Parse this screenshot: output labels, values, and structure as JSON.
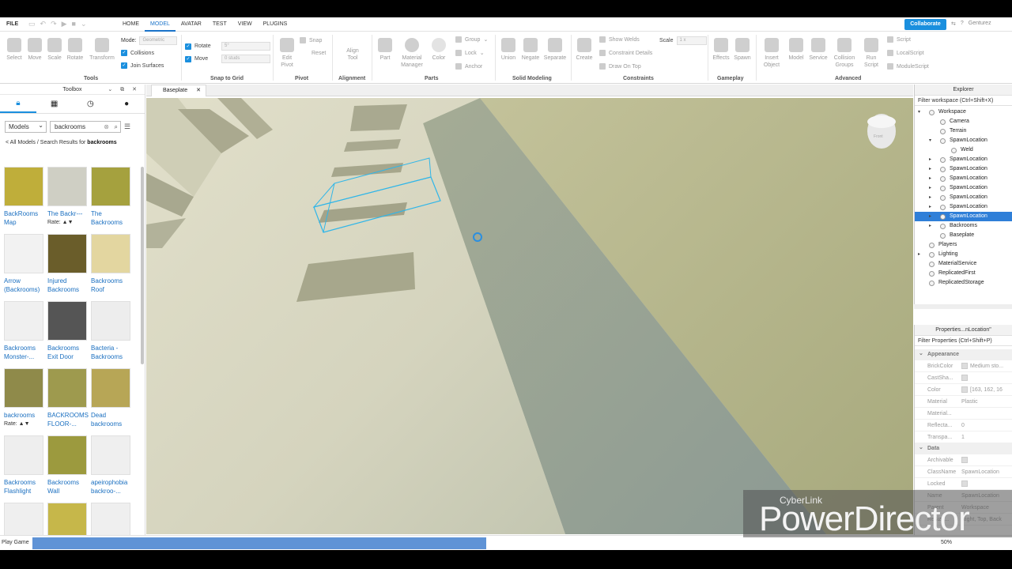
{
  "menu": {
    "file": "FILE",
    "tabs": [
      "HOME",
      "MODEL",
      "AVATAR",
      "TEST",
      "VIEW",
      "PLUGINS"
    ],
    "active_tab": "MODEL",
    "collaborate": "Collaborate",
    "user": "Genturez"
  },
  "ribbon": {
    "tools": [
      "Select",
      "Move",
      "Scale",
      "Rotate",
      "Transform"
    ],
    "mode_label": "Mode:",
    "mode_value": "Geometric",
    "collisions": "Collisions",
    "join_surfaces": "Join Surfaces",
    "rotate_label": "Rotate",
    "rotate_value": "5°",
    "move_label": "Move",
    "move_value": "0 studs",
    "edit_pivot": "Edit Pivot",
    "snap": "Snap",
    "reset": "Reset",
    "align_tool": "Align Tool",
    "part": "Part",
    "material_manager": "Material Manager",
    "color": "Color",
    "group": "Group",
    "lock": "Lock",
    "anchor": "Anchor",
    "union": "Union",
    "negate": "Negate",
    "separate": "Separate",
    "create": "Create",
    "show_welds": "Show Welds",
    "constraint_details": "Constraint Details",
    "draw_on_top": "Draw On Top",
    "scale_label": "Scale",
    "scale_value": "1 x",
    "effects": "Effects",
    "spawn": "Spawn",
    "insert_object": "Insert Object",
    "model": "Model",
    "service": "Service",
    "collision_groups": "Collision Groups",
    "run_script": "Run Script",
    "script": "Script",
    "local_script": "LocalScript",
    "module_script": "ModuleScript",
    "groups": [
      "Tools",
      "Snap to Grid",
      "Pivot",
      "Alignment",
      "Parts",
      "Solid Modeling",
      "Constraints",
      "Gameplay",
      "Advanced"
    ]
  },
  "toolbox": {
    "title": "Toolbox",
    "category": "Models",
    "search": "backrooms",
    "crumb_prefix": "< All Models / Search Results for ",
    "crumb_term": "backrooms",
    "rate_label": "Rate:",
    "items": [
      {
        "name": "BackRooms Map",
        "color": "#bfae3a",
        "rate": false
      },
      {
        "name": "The Backr---",
        "color": "#cfcfc4",
        "rate": true
      },
      {
        "name": "The Backrooms",
        "color": "#a5a13e",
        "rate": false
      },
      {
        "name": "Arrow (Backrooms)",
        "color": "#f2f2f2",
        "rate": false
      },
      {
        "name": "Injured Backrooms",
        "color": "#6a5d2a",
        "rate": false
      },
      {
        "name": "Backrooms Roof",
        "color": "#e3d6a0",
        "rate": false
      },
      {
        "name": "Backrooms Monster-...",
        "color": "#f0f0f0",
        "rate": false
      },
      {
        "name": "Backrooms Exit Door",
        "color": "#555555",
        "rate": false
      },
      {
        "name": "Bacteria - Backrooms",
        "color": "#ededed",
        "rate": false
      },
      {
        "name": "backrooms",
        "color": "#8f8a4a",
        "rate": true
      },
      {
        "name": "BACKROOMS FLOOR-...",
        "color": "#9e9a4e",
        "rate": false
      },
      {
        "name": "Dead backrooms",
        "color": "#b7a656",
        "rate": false
      },
      {
        "name": "Backrooms Flashlight",
        "color": "#eeeeee",
        "rate": false
      },
      {
        "name": "Backrooms Wall",
        "color": "#9c9a3e",
        "rate": false
      },
      {
        "name": "apeirophobia backroo-...",
        "color": "#efefef",
        "rate": false
      },
      {
        "name": "",
        "color": "#efefef",
        "rate": false
      },
      {
        "name": "",
        "color": "#c6b74a",
        "rate": false
      },
      {
        "name": "",
        "color": "#efefef",
        "rate": false
      }
    ]
  },
  "viewport": {
    "tab": "Baseplate"
  },
  "explorer": {
    "title": "Explorer",
    "filter": "Filter workspace (Ctrl+Shift+X)",
    "rows": [
      {
        "label": "Workspace",
        "indent": 0,
        "arrow": "▾",
        "selected": false
      },
      {
        "label": "Camera",
        "indent": 1,
        "arrow": "",
        "selected": false
      },
      {
        "label": "Terrain",
        "indent": 1,
        "arrow": "",
        "selected": false
      },
      {
        "label": "SpawnLocation",
        "indent": 1,
        "arrow": "▾",
        "selected": false
      },
      {
        "label": "Weld",
        "indent": 2,
        "arrow": "",
        "selected": false
      },
      {
        "label": "SpawnLocation",
        "indent": 1,
        "arrow": "▸",
        "selected": false
      },
      {
        "label": "SpawnLocation",
        "indent": 1,
        "arrow": "▸",
        "selected": false
      },
      {
        "label": "SpawnLocation",
        "indent": 1,
        "arrow": "▸",
        "selected": false
      },
      {
        "label": "SpawnLocation",
        "indent": 1,
        "arrow": "▸",
        "selected": false
      },
      {
        "label": "SpawnLocation",
        "indent": 1,
        "arrow": "▸",
        "selected": false
      },
      {
        "label": "SpawnLocation",
        "indent": 1,
        "arrow": "▸",
        "selected": false
      },
      {
        "label": "SpawnLocation",
        "indent": 1,
        "arrow": "▸",
        "selected": true
      },
      {
        "label": "Backrooms",
        "indent": 1,
        "arrow": "▸",
        "selected": false
      },
      {
        "label": "Baseplate",
        "indent": 1,
        "arrow": "",
        "selected": false
      },
      {
        "label": "Players",
        "indent": 0,
        "arrow": "",
        "selected": false
      },
      {
        "label": "Lighting",
        "indent": 0,
        "arrow": "▸",
        "selected": false
      },
      {
        "label": "MaterialService",
        "indent": 0,
        "arrow": "",
        "selected": false
      },
      {
        "label": "ReplicatedFirst",
        "indent": 0,
        "arrow": "",
        "selected": false
      },
      {
        "label": "ReplicatedStorage",
        "indent": 0,
        "arrow": "",
        "selected": false
      }
    ]
  },
  "properties": {
    "title": "Properties...nLocation\"",
    "filter": "Filter Properties (Ctrl+Shift+P)",
    "appearance": "Appearance",
    "data": "Data",
    "rows_appearance": [
      {
        "k": "BrickColor",
        "v": "Medium sto...",
        "box": true
      },
      {
        "k": "CastSha...",
        "v": "",
        "box": true
      },
      {
        "k": "Color",
        "v": "[163, 162, 16",
        "box": true
      },
      {
        "k": "Material",
        "v": "Plastic",
        "box": false
      },
      {
        "k": "Material...",
        "v": "",
        "box": false
      },
      {
        "k": "Reflecta...",
        "v": "0",
        "box": false
      },
      {
        "k": "Transpa...",
        "v": "1",
        "box": false
      }
    ],
    "rows_data": [
      {
        "k": "Archivable",
        "v": "",
        "box": true
      },
      {
        "k": "ClassName",
        "v": "SpawnLocation",
        "box": false
      },
      {
        "k": "Locked",
        "v": "",
        "box": true
      },
      {
        "k": "Name",
        "v": "SpawnLocation",
        "box": false
      },
      {
        "k": "Parent",
        "v": "Workspace",
        "box": false
      },
      {
        "k": "Resize...",
        "v": "Right, Top, Back",
        "box": false
      }
    ]
  },
  "status": {
    "label": "Play Game",
    "progress_fraction": 0.5,
    "percent": "50%"
  },
  "watermark": {
    "small": "CyberLink",
    "big": "PowerDirector"
  }
}
